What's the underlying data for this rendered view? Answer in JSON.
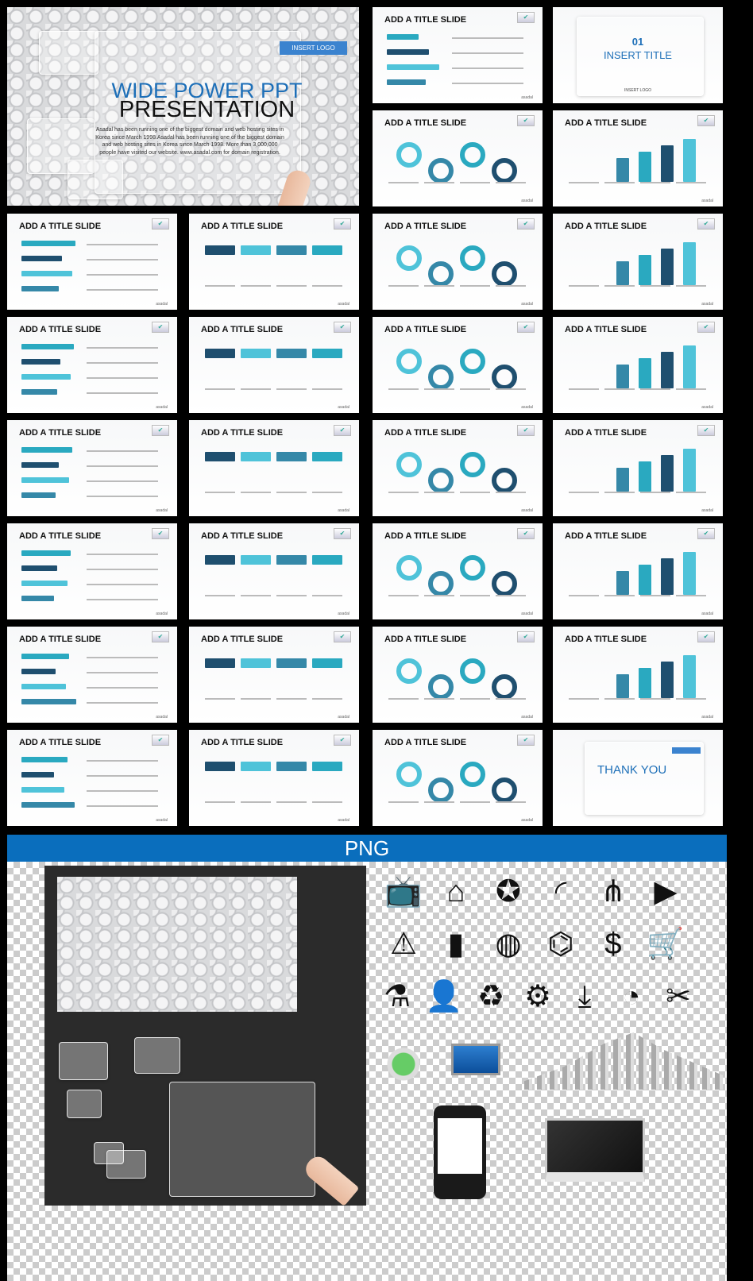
{
  "hero": {
    "title_line1": "WIDE POWER PPT",
    "title_line2": "PRESENTATION",
    "logo_button": "INSERT LOGO",
    "description": "Asadal has been running one of the biggest domain and web hosting sites in Korea since March 1998.Asadal has been running one of the biggest domain and web hosting sites in Korea since March 1998. More than 3,000,000 people have visited our website. www.asadal.com for domain registration."
  },
  "section_slide": {
    "number": "01",
    "title": "INSERT TITLE",
    "logo": "INSERT LOGO"
  },
  "slide_title": "ADD A TITLE SLIDE",
  "footer": "asadal",
  "check_icon": "✔",
  "thank_you": "THANK YOU",
  "png_banner": "PNG",
  "colors": {
    "accent_blue": "#1d6fb8",
    "teal": "#2aa9c0",
    "navy": "#1f4f6f",
    "banner": "#0a6ebd"
  },
  "png_icons": [
    "tv-icon",
    "home-icon",
    "award-icon",
    "rss-icon",
    "share-icon",
    "video-icon",
    "warning-icon",
    "battery-icon",
    "globe-icon",
    "satellite-icon",
    "money-bag-icon",
    "cart-icon",
    "flask-plus-icon",
    "user-plus-icon",
    "recycle-icon",
    "gears-icon",
    "download-icon",
    "pie-icon",
    "tools-icon"
  ]
}
